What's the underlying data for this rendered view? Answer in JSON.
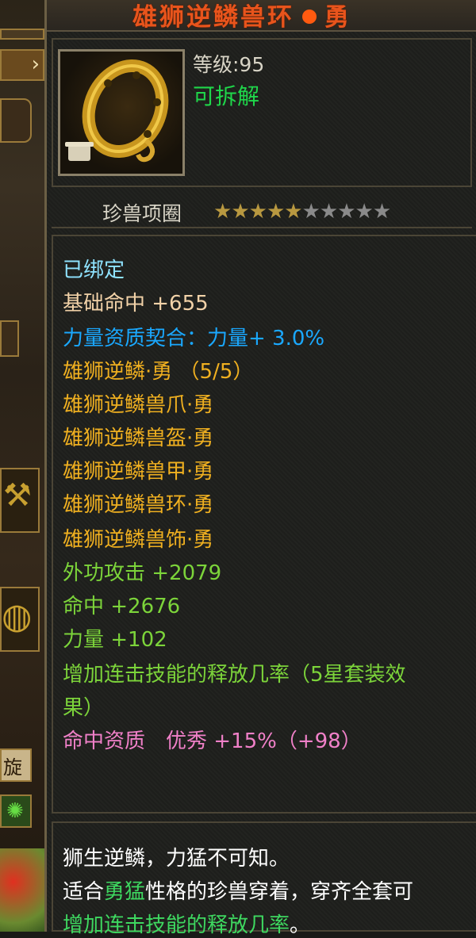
{
  "colors": {
    "title": "#e8541c",
    "bound": "#8fe3ff",
    "base_stat": "#f2d2a8",
    "bonus_blue": "#1aa8ff",
    "set_gold": "#f0b020",
    "green": "#7cd43a",
    "pink": "#f080c8",
    "dismantle": "#1fd64a",
    "star_filled": "#b89840",
    "star_empty": "#8a8a8a"
  },
  "item": {
    "title": "雄狮逆鳞兽环",
    "title_suffix": "勇",
    "icon": "golden-beast-ring-icon",
    "level": "等级:95",
    "dismantle": "可拆解",
    "category": "珍兽项圈",
    "stars_filled": 5,
    "stars_total": 10
  },
  "stats": {
    "bound": "已绑定",
    "base": "基础命中 +655",
    "aptitude_bonus": "力量资质契合：力量+ 3.0%",
    "set_name": "雄狮逆鳞·勇 （5/5）",
    "set_items": [
      "雄狮逆鳞兽爪·勇",
      "雄狮逆鳞兽盔·勇",
      "雄狮逆鳞兽甲·勇",
      "雄狮逆鳞兽环·勇",
      "雄狮逆鳞兽饰·勇"
    ],
    "set_bonus": [
      "外功攻击 +2079",
      "命中 +2676",
      "力量 +102",
      "增加连击技能的释放几率（5星套装效",
      "果）"
    ],
    "aptitude": "命中资质　优秀 +15%（+98）"
  },
  "description": {
    "line1": "狮生逆鳞，力猛不可知。",
    "line2_pre": "适合",
    "line2_highlight": "勇猛",
    "line2_post": "性格的珍兽穿着，穿齐全套可",
    "line3_highlight": "增加连击技能的释放几率",
    "line3_post": "。"
  },
  "left_panel": {
    "tab_glyph": "旋"
  }
}
